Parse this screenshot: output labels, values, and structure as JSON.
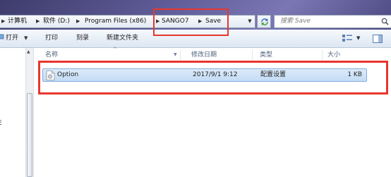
{
  "address_bar": {
    "breadcrumbs": [
      "计算机",
      "软件 (D:)",
      "Program Files (x86)",
      "SANGO7",
      "Save"
    ],
    "search_placeholder": "搜索 Save"
  },
  "toolbar": {
    "open_label": "打开",
    "print_label": "打印",
    "burn_label": "刻录",
    "new_folder_label": "新建文件夹"
  },
  "columns": {
    "name": "名称",
    "date_modified": "修改日期",
    "type": "类型",
    "size": "大小"
  },
  "files": [
    {
      "name": "Option",
      "date_modified": "2017/9/1 9:12",
      "type": "配置设置",
      "size": "1 KB",
      "icon": "config-file-icon",
      "selected": true
    }
  ],
  "nav_pane": {
    "fragment_text": "E"
  },
  "colors": {
    "selection_bg": "#c3dcf6",
    "annotation_red": "#e8362e",
    "header_text": "#4c607a"
  }
}
